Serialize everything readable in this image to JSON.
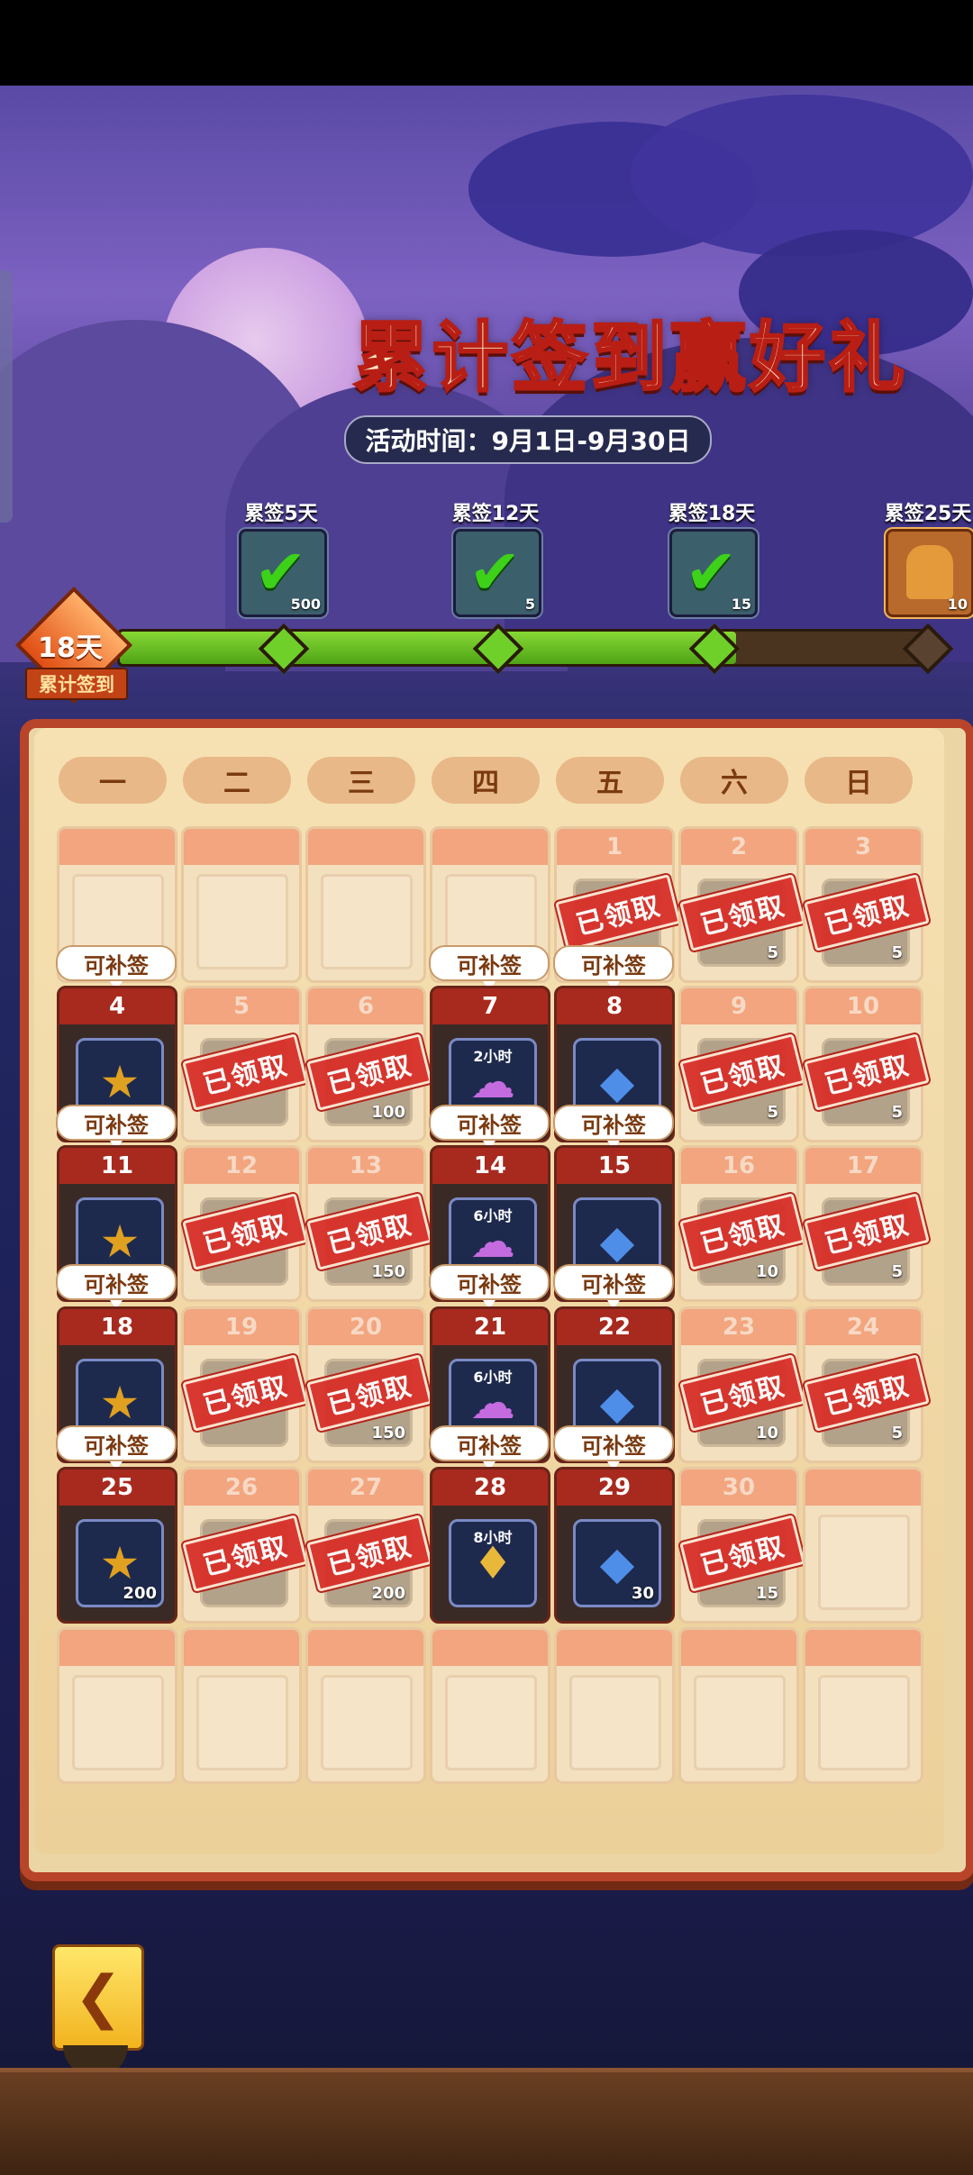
{
  "title": "累计签到赢好礼",
  "activity_time": "活动时间：9月1日-9月30日",
  "progress": {
    "days_value": "18天",
    "days_label": "累计签到",
    "fraction": 0.76,
    "milestones": [
      {
        "label": "累签5天",
        "count": "500",
        "icon": "green-token-icon",
        "claimed": true
      },
      {
        "label": "累签12天",
        "count": "5",
        "icon": "green-token-icon",
        "claimed": true
      },
      {
        "label": "累签18天",
        "count": "15",
        "icon": "green-token-icon",
        "claimed": true
      },
      {
        "label": "累签25天",
        "count": "10",
        "icon": "treasure-chest-icon",
        "claimed": false
      }
    ]
  },
  "weekdays": [
    "一",
    "二",
    "三",
    "四",
    "五",
    "六",
    "日"
  ],
  "labels": {
    "claimed": "已领取",
    "makeup": "可补签"
  },
  "calendar": [
    {
      "day": "",
      "state": "empty",
      "makeup": true
    },
    {
      "day": "",
      "state": "empty"
    },
    {
      "day": "",
      "state": "empty"
    },
    {
      "day": "",
      "state": "empty",
      "makeup": true
    },
    {
      "day": "1",
      "state": "claimed",
      "makeup": true
    },
    {
      "day": "2",
      "state": "claimed",
      "count": "5"
    },
    {
      "day": "3",
      "state": "claimed",
      "count": "5"
    },
    {
      "day": "4",
      "state": "active",
      "icon": "rainbow-star-icon",
      "makeup": true
    },
    {
      "day": "5",
      "state": "claimed"
    },
    {
      "day": "6",
      "state": "claimed",
      "count": "100"
    },
    {
      "day": "7",
      "state": "active",
      "icon": "purple-cloud-icon",
      "small": "2小时",
      "makeup": true
    },
    {
      "day": "8",
      "state": "active",
      "icon": "blue-shard-icon",
      "makeup": true
    },
    {
      "day": "9",
      "state": "claimed",
      "count": "5"
    },
    {
      "day": "10",
      "state": "claimed",
      "count": "5"
    },
    {
      "day": "11",
      "state": "active",
      "icon": "rainbow-star-icon",
      "makeup": true
    },
    {
      "day": "12",
      "state": "claimed"
    },
    {
      "day": "13",
      "state": "claimed",
      "count": "150"
    },
    {
      "day": "14",
      "state": "active",
      "icon": "purple-cloud-icon",
      "small": "6小时",
      "makeup": true
    },
    {
      "day": "15",
      "state": "active",
      "icon": "blue-shard-icon",
      "makeup": true
    },
    {
      "day": "16",
      "state": "claimed",
      "count": "10"
    },
    {
      "day": "17",
      "state": "claimed",
      "count": "5"
    },
    {
      "day": "18",
      "state": "active",
      "icon": "rainbow-star-icon",
      "makeup": true
    },
    {
      "day": "19",
      "state": "claimed"
    },
    {
      "day": "20",
      "state": "claimed",
      "count": "150"
    },
    {
      "day": "21",
      "state": "active",
      "icon": "purple-cloud-icon",
      "small": "6小时",
      "makeup": true
    },
    {
      "day": "22",
      "state": "active",
      "icon": "blue-shard-icon",
      "makeup": true
    },
    {
      "day": "23",
      "state": "claimed",
      "count": "10"
    },
    {
      "day": "24",
      "state": "claimed",
      "count": "5"
    },
    {
      "day": "25",
      "state": "active",
      "icon": "rainbow-star-icon",
      "count": "200"
    },
    {
      "day": "26",
      "state": "claimed"
    },
    {
      "day": "27",
      "state": "claimed",
      "count": "200"
    },
    {
      "day": "28",
      "state": "active",
      "icon": "gift-bag-icon",
      "small": "8小时",
      "purple": true
    },
    {
      "day": "29",
      "state": "active",
      "icon": "blue-shard-icon",
      "count": "30"
    },
    {
      "day": "30",
      "state": "claimed",
      "count": "15"
    },
    {
      "day": "",
      "state": "empty"
    },
    {
      "day": "",
      "state": "empty"
    },
    {
      "day": "",
      "state": "empty"
    },
    {
      "day": "",
      "state": "empty"
    },
    {
      "day": "",
      "state": "empty"
    },
    {
      "day": "",
      "state": "empty"
    },
    {
      "day": "",
      "state": "empty"
    },
    {
      "day": "",
      "state": "empty"
    }
  ],
  "icons": {
    "back": "back-arrow-icon",
    "check": "checkmark-icon"
  },
  "colors": {
    "title_fill": "#f8e6c2",
    "title_stroke": "#b81e14",
    "claimed_stamp": "#d8302a",
    "progress_fill": "#6fd02a"
  }
}
